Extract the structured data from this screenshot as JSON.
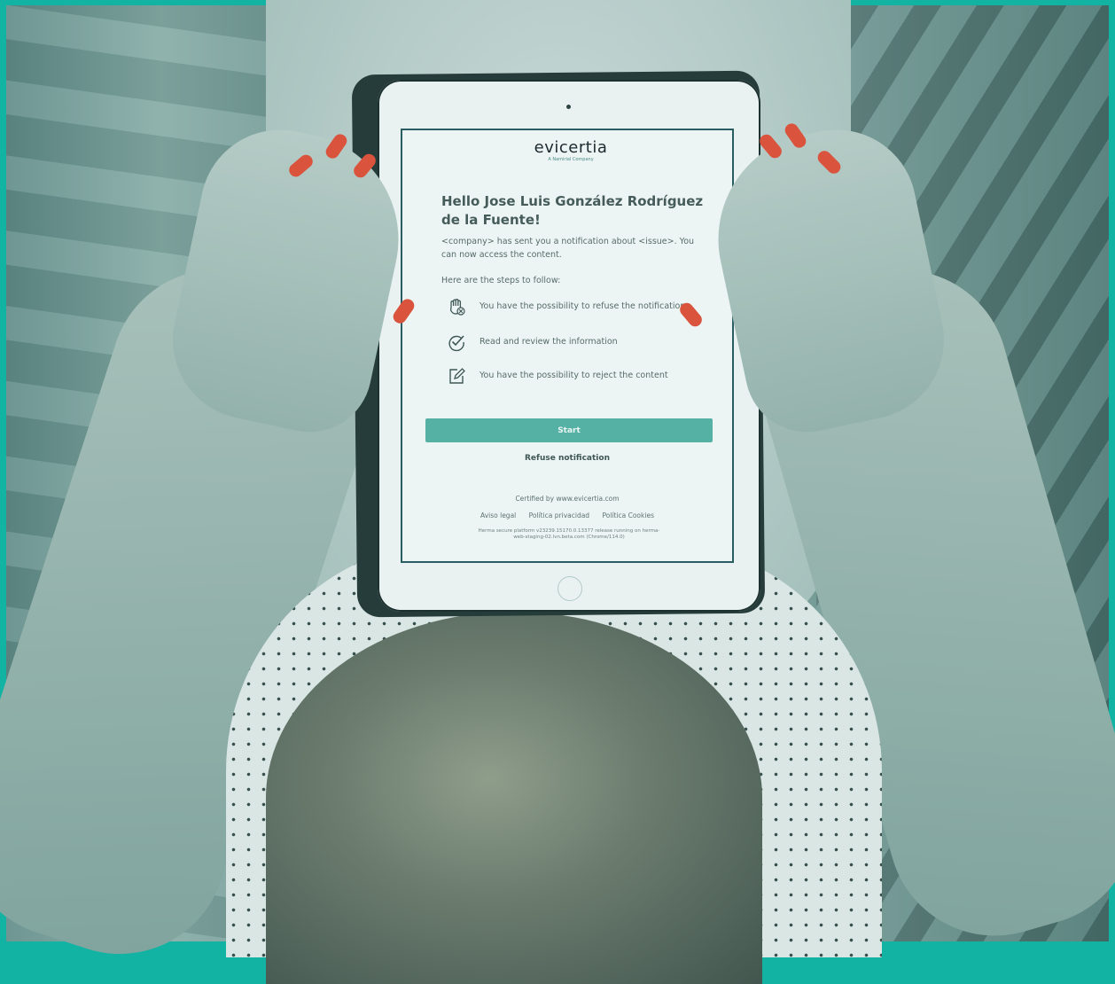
{
  "brand": {
    "logo_text": "evicertia",
    "logo_tagline": "A Namirial Company",
    "accent_color": "#56b1a5",
    "frame_color": "#13b3a3"
  },
  "notification": {
    "greeting": "Hello Jose Luis González Rodríguez de la Fuente!",
    "intro": "<company> has sent you a notification about <issue>. You can now access the content.",
    "steps_intro": "Here are the steps to follow:",
    "steps": [
      {
        "icon": "hand-stop-icon",
        "text": "You have the possibility to refuse the notification"
      },
      {
        "icon": "check-circle-icon",
        "text": "Read and review the information"
      },
      {
        "icon": "edit-icon",
        "text": "You have the possibility to reject the content"
      }
    ],
    "start_label": "Start",
    "refuse_label": "Refuse notification"
  },
  "footer": {
    "certified": "Certified by www.evicertia.com",
    "links": [
      "Aviso legal",
      "Política privacidad",
      "Política Cookies"
    ],
    "platform_info": "Herma secure platform v23239.15170.0.13377 release running on herma-web-staging-02.lvn.beta.com (Chrome/114.0)"
  }
}
